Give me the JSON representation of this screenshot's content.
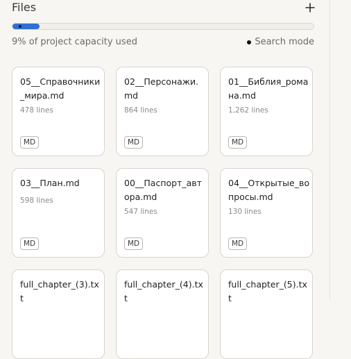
{
  "panel": {
    "title": "Files",
    "add_icon": "plus-icon",
    "capacity_fraction": 0.09,
    "capacity_text": "9% of project capacity used",
    "search_mode": "Search mode"
  },
  "files": [
    {
      "name": "05__Справочники_мира.md",
      "lines": "478 lines",
      "type": "MD"
    },
    {
      "name": "02__Персонажи.md",
      "lines": "864 lines",
      "type": "MD"
    },
    {
      "name": "01__Библия_романа.md",
      "lines": "1,262 lines",
      "type": "MD"
    },
    {
      "name": "03__План.md",
      "lines": "598 lines",
      "type": "MD"
    },
    {
      "name": "00__Паспорт_автора.md",
      "lines": "547 lines",
      "type": "MD"
    },
    {
      "name": "04__Открытые_вопросы.md",
      "lines": "130 lines",
      "type": "MD"
    },
    {
      "name": "full_chapter_(3).txt",
      "lines": "",
      "type": ""
    },
    {
      "name": "full_chapter_(4).txt",
      "lines": "",
      "type": ""
    },
    {
      "name": "full_chapter_(5).txt",
      "lines": "",
      "type": ""
    }
  ]
}
